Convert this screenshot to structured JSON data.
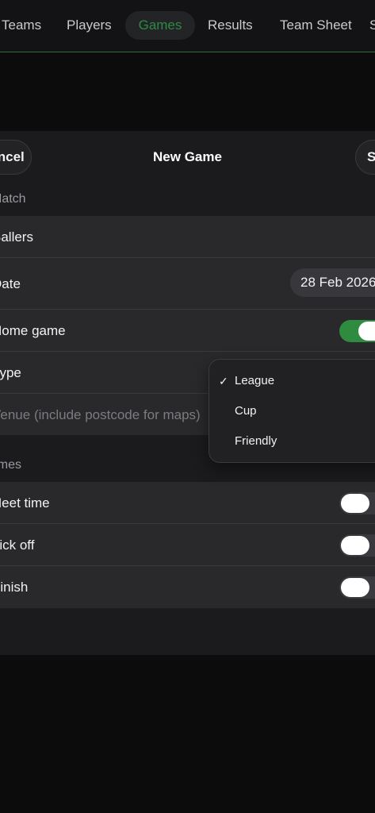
{
  "nav": {
    "tabs": [
      {
        "label": "Teams"
      },
      {
        "label": "Players"
      },
      {
        "label": "Games"
      },
      {
        "label": "Results"
      },
      {
        "label": "Team Sheet"
      }
    ],
    "more_glyph": "S"
  },
  "sheet": {
    "cancel_label": "Cancel",
    "title": "New Game",
    "save_label": "Save",
    "match_section": "Match",
    "opponent_value": "Ballers",
    "date_label": "Date",
    "date_value": "28 Feb 2026",
    "home_label": "Home game",
    "type_label": "Type",
    "venue_placeholder": "Venue (include postcode for maps)",
    "times_section": "Times",
    "meet_label": "Meet time",
    "kickoff_label": "Kick off",
    "finish_label": "Finish"
  },
  "toggles": {
    "home_game": true,
    "meet_time": false,
    "kick_off": false,
    "finish": false
  },
  "type_menu": {
    "check_glyph": "✓",
    "options": [
      {
        "label": "League",
        "selected": true
      },
      {
        "label": "Cup",
        "selected": false
      },
      {
        "label": "Friendly",
        "selected": false
      }
    ]
  },
  "colors": {
    "accent_green": "#2f8b3f",
    "active_tab_text": "#2e8a45"
  }
}
